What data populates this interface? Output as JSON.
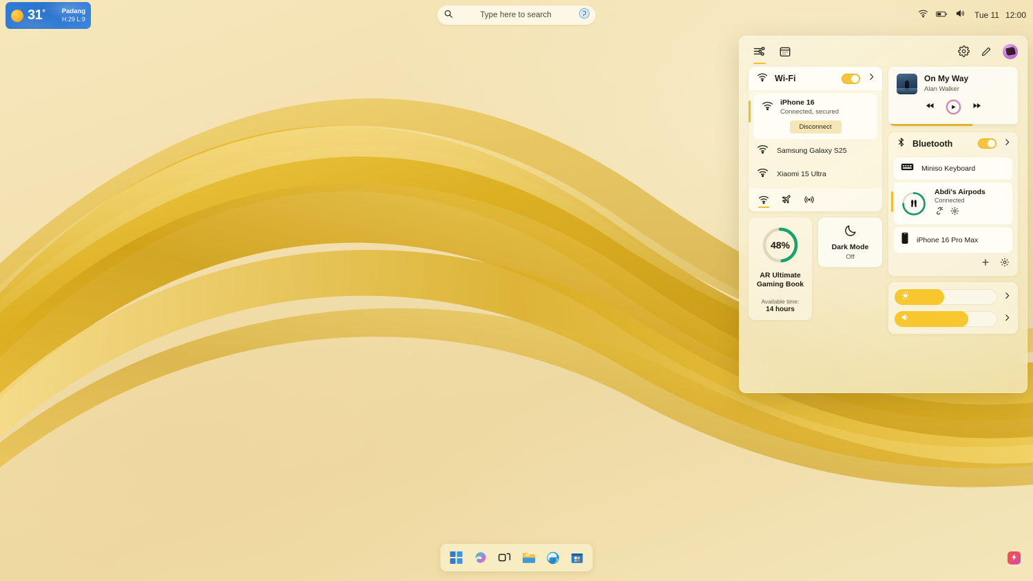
{
  "weather": {
    "temperature": "31",
    "degree_symbol": "°",
    "city": "Padang",
    "high_low": "H:29 L:9",
    "icon": "sun-icon"
  },
  "search": {
    "placeholder": "Type here to search",
    "icon": "search-icon",
    "assistant_icon": "copilot-icon"
  },
  "tray": {
    "wifi_icon": "wifi-icon",
    "battery_icon": "battery-icon",
    "volume_icon": "volume-icon",
    "date": "Tue 11",
    "time": "12:00"
  },
  "quick_settings": {
    "header": {
      "quick_settings_icon": "sliders-icon",
      "calendar_icon": "calendar-icon",
      "settings_icon": "gear-icon",
      "edit_icon": "pencil-icon",
      "avatar_icon": "avatar"
    },
    "wifi": {
      "label": "Wi-Fi",
      "toggle_state": "on",
      "icon": "wifi-icon",
      "chevron_icon": "chevron-right-icon",
      "connected": {
        "name": "iPhone 16",
        "status": "Connected, secured",
        "action": "Disconnect"
      },
      "networks": [
        {
          "name": "Samsung Galaxy S25"
        },
        {
          "name": "Xiaomi 15 Ultra"
        }
      ],
      "footer_icons": [
        "wifi-icon",
        "airplane-mode-icon",
        "mobile-hotspot-icon"
      ]
    },
    "battery": {
      "percent_label": "48%",
      "percent_value": 48,
      "device_name": "AR Ultimate\nGaming Book",
      "device_name_line1": "AR Ultimate",
      "device_name_line2": "Gaming Book",
      "available_label": "Available time:",
      "available_value": "14 hours",
      "ring_color": "#13a56a"
    },
    "dark_mode": {
      "label": "Dark Mode",
      "state": "Off",
      "icon": "moon-icon"
    },
    "media": {
      "title": "On My Way",
      "artist": "Alan Walker",
      "prev_icon": "previous-icon",
      "play_icon": "play-icon",
      "next_icon": "next-icon",
      "progress_percent": 65
    },
    "bluetooth": {
      "label": "Bluetooth",
      "toggle_state": "on",
      "icon": "bluetooth-icon",
      "chevron_icon": "chevron-right-icon",
      "devices": [
        {
          "name": "Miniso Keyboard",
          "icon": "keyboard-icon"
        },
        {
          "name": "Abdi's Airpods",
          "status": "Connected",
          "icon": "airpods-icon",
          "battery_percent": 75
        },
        {
          "name": "iPhone 16 Pro Max",
          "icon": "phone-icon"
        }
      ],
      "add_icon": "plus-icon",
      "settings_icon": "gear-icon"
    },
    "sliders": [
      {
        "name": "brightness",
        "icon": "brightness-icon",
        "value": 48,
        "chevron_icon": "chevron-right-icon"
      },
      {
        "name": "volume",
        "icon": "volume-icon",
        "value": 72,
        "chevron_icon": "chevron-right-icon"
      }
    ]
  },
  "taskbar": {
    "items": [
      {
        "name": "start-button",
        "icon": "windows-logo-icon"
      },
      {
        "name": "copilot-button",
        "icon": "copilot-icon"
      },
      {
        "name": "task-view-button",
        "icon": "task-view-icon"
      },
      {
        "name": "file-explorer-button",
        "icon": "folder-icon"
      },
      {
        "name": "edge-button",
        "icon": "edge-icon"
      },
      {
        "name": "microsoft-store-button",
        "icon": "store-icon"
      }
    ],
    "corner_app": {
      "name": "lightning-app",
      "icon": "lightning-bolt-icon"
    }
  }
}
